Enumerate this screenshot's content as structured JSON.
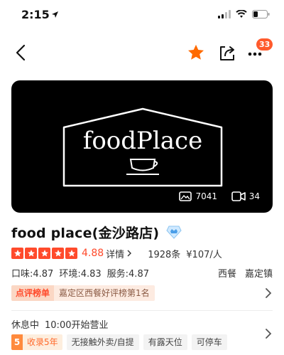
{
  "status_bar": {
    "time": "2:15"
  },
  "nav": {
    "more_badge": "33"
  },
  "cover": {
    "logo_text": "foodPlace",
    "photo_count": "7041",
    "video_count": "34"
  },
  "shop": {
    "name": "food place(金沙路店)",
    "score": "4.88",
    "detail_link": "详情",
    "review_count": "1928条",
    "avg_price": "¥107/人",
    "taste": "口味:4.87",
    "environment": "环境:4.83",
    "service": "服务:4.87",
    "cuisine": "西餐",
    "area": "嘉定镇",
    "rank_label": "点评榜单",
    "rank_text": "嘉定区西餐好评榜第1名",
    "status": "休息中",
    "open_time": "10:00开始营业",
    "years_num": "5",
    "years_text": "收录5年",
    "features": [
      "无接触外卖/自提",
      "有露天位",
      "可停车"
    ]
  },
  "colors": {
    "accent": "#ff4a2b",
    "star": "#ff6a00"
  }
}
